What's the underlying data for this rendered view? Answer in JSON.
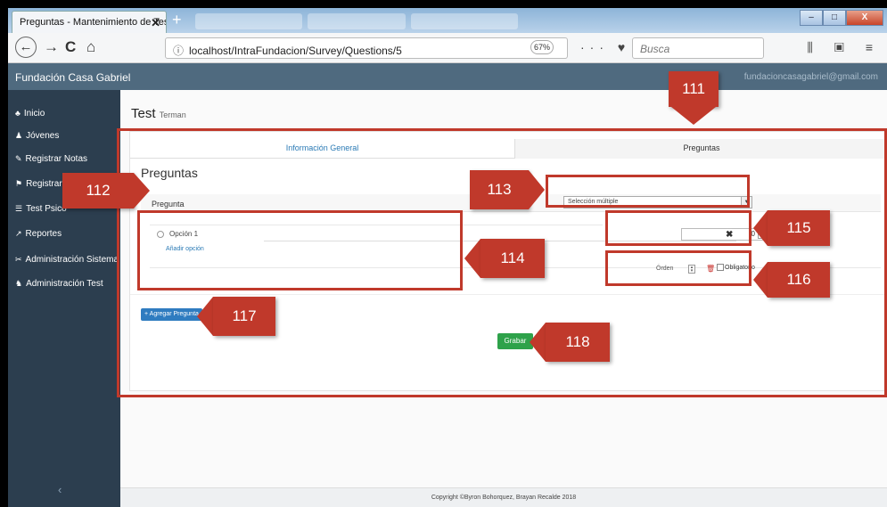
{
  "browser": {
    "tab_title": "Preguntas - Mantenimiento de Test",
    "tab_close": "✕",
    "new_tab": "+",
    "url": "localhost/IntraFundacion/Survey/Questions/5",
    "info_icon": "ⓘ",
    "zoom": "67%",
    "page_actions": "··· ♥ ☆",
    "search_placeholder": "Busca",
    "library_icons": "⫼ ▣ ≡",
    "back": "←",
    "forward": "→",
    "reload": "C",
    "home": "⌂",
    "win_min": "‒",
    "win_max": "□",
    "win_close": "X"
  },
  "app": {
    "brand": "Fundación Casa Gabriel",
    "user_email": "fundacioncasagabriel@gmail.com"
  },
  "sidebar": {
    "items": [
      {
        "icon": "home-icon",
        "glyph": "♣",
        "label": "Inicio"
      },
      {
        "icon": "user-icon",
        "glyph": "♟",
        "label": "Jóvenes"
      },
      {
        "icon": "edit-icon",
        "glyph": "✎",
        "label": "Registrar Notas"
      },
      {
        "icon": "flag-icon",
        "glyph": "⚑",
        "label": "Registrar"
      },
      {
        "icon": "list-icon",
        "glyph": "☰",
        "label": "Test Psico"
      },
      {
        "icon": "chart-icon",
        "glyph": "↗",
        "label": "Reportes"
      },
      {
        "icon": "wrench-icon",
        "glyph": "✂",
        "label": "Administración Sistema"
      },
      {
        "icon": "users-icon",
        "glyph": "♞",
        "label": "Administración Test"
      }
    ],
    "collapse": "‹"
  },
  "page": {
    "title": "Test",
    "subtitle": "Terman",
    "tabs": [
      "Información General",
      "Preguntas"
    ],
    "section_title": "Preguntas",
    "question_placeholder": "Pregunta",
    "type_select": "Selección múltiple",
    "option_label": "Opción 1",
    "add_option": "Añadir opción",
    "score_value": "0",
    "delete_option": "✖",
    "order_label": "Órden",
    "required_label": "Obligatorio",
    "add_question": "+ Agregar Pregunta",
    "save": "Grabar",
    "footer": "Copyright ©Byron Bohorquez, Brayan Recalde 2018"
  },
  "annotations": [
    "111",
    "112",
    "113",
    "114",
    "115",
    "116",
    "117",
    "118"
  ],
  "colors": {
    "annotation": "#c0392b",
    "header": "#4f6a7f",
    "sidebar": "#2c3e4f",
    "primary": "#2f7cc0",
    "success": "#2ea24a"
  }
}
